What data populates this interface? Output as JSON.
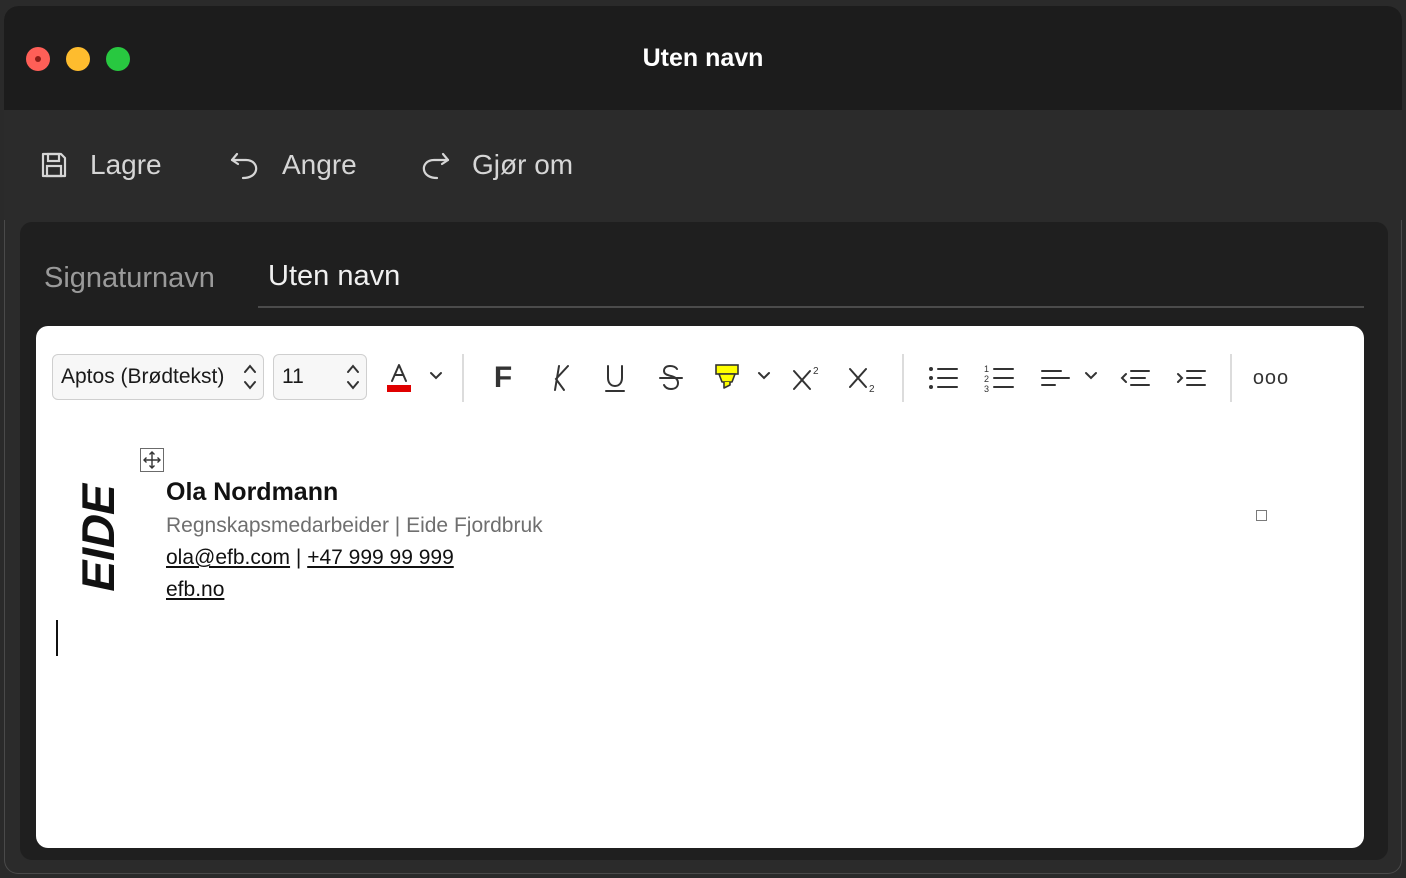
{
  "window": {
    "title": "Uten navn"
  },
  "commands": {
    "save": "Lagre",
    "undo": "Angre",
    "redo": "Gjør om"
  },
  "signature_name": {
    "label": "Signaturnavn",
    "value": "Uten navn"
  },
  "toolbar": {
    "font_family": "Aptos (Brødtekst)",
    "font_size": "11",
    "bold_glyph": "F",
    "italic_glyph": "K",
    "underline_glyph": "U",
    "more_glyph": "ooo",
    "font_color": "#e00000",
    "highlight_color": "#ffff00"
  },
  "signature": {
    "logo_text": "EIDE",
    "name": "Ola Nordmann",
    "role": "Regnskapsmedarbeider | Eide Fjordbruk",
    "email": "ola@efb.com",
    "separator": "|",
    "phone": "+47 999 99 999",
    "website": "efb.no"
  },
  "colors": {
    "title_bar": "#1c1c1c",
    "window_bg": "#2b2b2b",
    "panel_bg": "#1f1f1f",
    "editor_bg": "#ffffff"
  }
}
